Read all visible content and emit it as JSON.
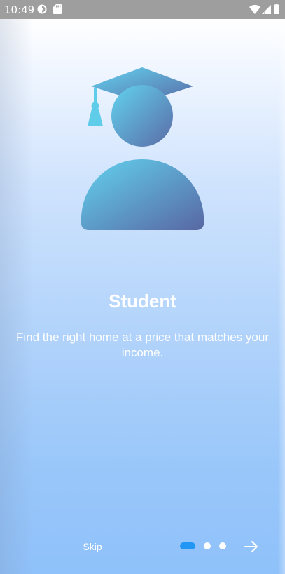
{
  "status_bar": {
    "time": "10:49",
    "left_icons": [
      "data-saver-icon",
      "sd-card-icon"
    ],
    "right_icons": [
      "wifi-icon",
      "cell-signal-icon",
      "battery-icon"
    ]
  },
  "onboarding": {
    "illustration_icon": "graduate-person-icon",
    "title": "Student",
    "description": "Find the right home at a price that matches your income.",
    "skip_label": "Skip",
    "next_icon": "arrow-right-icon",
    "page_count": 3,
    "active_page": 1
  },
  "colors": {
    "accent": "#2196f3",
    "illustration_light": "#5fd0ee",
    "illustration_dark": "#5a6ca6",
    "status_bar": "#9e9e9e"
  }
}
